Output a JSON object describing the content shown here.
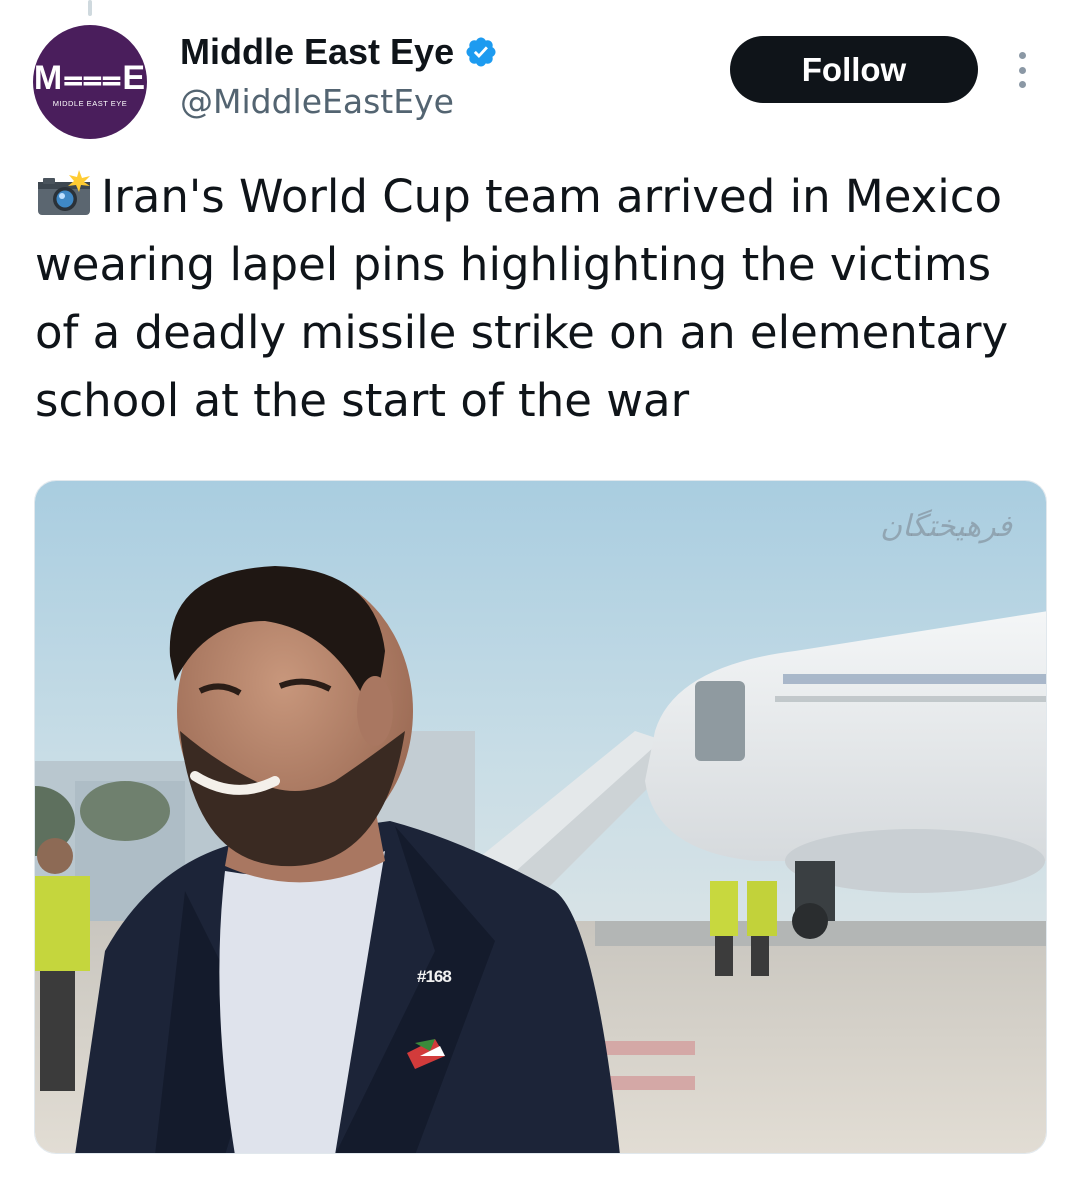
{
  "author": {
    "avatar_mark": "M⩶E",
    "avatar_subtitle": "MIDDLE EAST EYE",
    "display_name": "Middle East Eye",
    "verified": true,
    "handle": "@MiddleEastEye"
  },
  "actions": {
    "follow_label": "Follow"
  },
  "tweet": {
    "emoji_icon": "camera-flash-icon",
    "text": "Iran's World Cup team arrived in Mexico wearing lapel pins highlighting the victims of a deadly missile strike on an elementary school at the start of the war"
  },
  "media": {
    "watermark": "فرهیختگان",
    "pin_text": "#168"
  },
  "colors": {
    "avatar_bg": "#4a1e5c",
    "verified_blue": "#1d9bf0",
    "follow_bg": "#0f1419",
    "handle_gray": "#536471"
  }
}
